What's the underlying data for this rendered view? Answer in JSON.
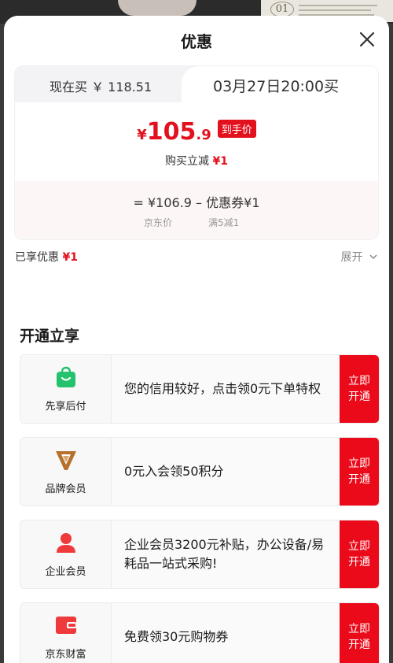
{
  "backdrop": {
    "number": "01"
  },
  "header": {
    "title": "优惠"
  },
  "price_card": {
    "tab_now": "现在买 ￥ 118.51",
    "tab_later": "03月27日20:00买",
    "price_symbol": "¥",
    "price_integer": "105",
    "price_decimal": ".9",
    "badge": "到手价",
    "reduce_label": "购买立减",
    "reduce_value": "¥1",
    "formula": "= ¥106.9 – 优惠券¥1",
    "formula_label_1": "京东价",
    "formula_label_2": "满5减1"
  },
  "summary": {
    "enjoyed_label": "已享优惠",
    "enjoyed_value": "¥1",
    "expand_label": "展开"
  },
  "open_section": {
    "title": "开通立享",
    "offers": [
      {
        "name": "先享后付",
        "desc": "您的信用较好，点击领0元下单特权",
        "button": "立即开通",
        "icon": "shopping-bag-icon",
        "color": "#25c26e"
      },
      {
        "name": "品牌会员",
        "desc": "0元入会领50积分",
        "button": "立即开通",
        "icon": "brand-v-icon",
        "color": "#b5702c"
      },
      {
        "name": "企业会员",
        "desc": "企业会员3200元补贴，办公设备/易耗品一站式采购!",
        "button": "立即开通",
        "icon": "person-icon",
        "color": "#ee3a3a"
      },
      {
        "name": "京东财富",
        "desc": "免费领30元购物券",
        "button": "立即开通",
        "icon": "wallet-icon",
        "color": "#ee3a3a"
      }
    ]
  },
  "colors": {
    "accent_red": "#e3111d",
    "button_red": "#ea0a19"
  }
}
